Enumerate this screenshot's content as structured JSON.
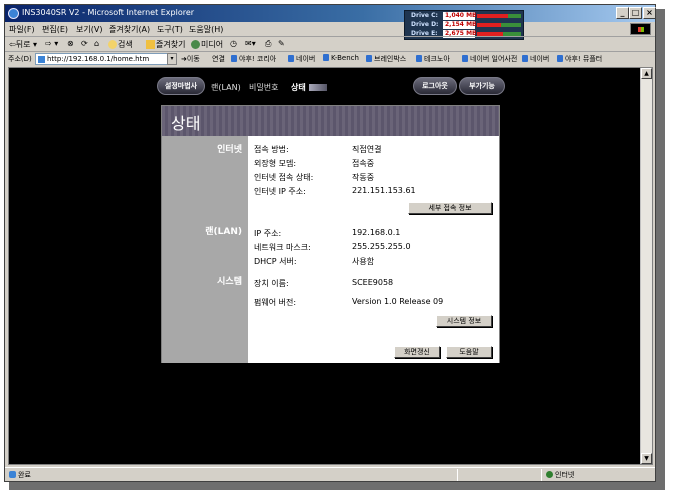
{
  "window": {
    "title": "INS3040SR V2 - Microsoft Internet Explorer",
    "controls": [
      "_",
      "□",
      "×"
    ]
  },
  "drives": [
    {
      "name": "Drive C:",
      "value": "1,040 MB",
      "usage": 0.7
    },
    {
      "name": "Drive D:",
      "value": "2,154 MB",
      "usage": 0.55
    },
    {
      "name": "Drive E:",
      "value": "2,675 MB",
      "usage": 0.6
    }
  ],
  "menu": [
    "파일(F)",
    "편집(E)",
    "보기(V)",
    "즐겨찾기(A)",
    "도구(T)",
    "도움말(H)"
  ],
  "toolbar": {
    "back": "뒤로",
    "search": "검색",
    "favorites": "즐겨찾기",
    "media": "미디어"
  },
  "address": {
    "label": "주소(D)",
    "url": "http://192.168.0.1/home.htm",
    "go": "이동",
    "links_label": "연결",
    "links": [
      "야후! 코리아",
      "네이버",
      "K-Bench",
      "브레인박스",
      "테크노아",
      "네이버 일어사전",
      "네이버",
      "야후! 뮤플터"
    ]
  },
  "nav": {
    "setup_wizard": "설정마법사",
    "items": [
      "랜(LAN)",
      "비밀번호",
      "상태"
    ],
    "logout": "로그아웃",
    "addons": "부가기능"
  },
  "panel": {
    "title": "상태",
    "internet": {
      "section": "인터넷",
      "rows": [
        {
          "k": "접속 방법:",
          "v": "직접연결"
        },
        {
          "k": "외장형 모뎀:",
          "v": "접속중"
        },
        {
          "k": "인터넷 접속 상태:",
          "v": "작동중"
        },
        {
          "k": "인터넷 IP 주소:",
          "v": "221.151.153.61"
        }
      ],
      "button": "세부 접속 정보"
    },
    "lan": {
      "section": "랜(LAN)",
      "rows": [
        {
          "k": "IP 주소:",
          "v": "192.168.0.1"
        },
        {
          "k": "네트워크 마스크:",
          "v": "255.255.255.0"
        },
        {
          "k": "DHCP 서버:",
          "v": "사용함"
        }
      ]
    },
    "system": {
      "section": "시스템",
      "rows": [
        {
          "k": "장치 이름:",
          "v": "SCEE9058"
        },
        {
          "k": "펌웨어 버전:",
          "v": "Version 1.0 Release 09"
        }
      ],
      "button": "시스템 정보"
    },
    "refresh": "화면갱신",
    "help": "도움말"
  },
  "status": {
    "left": "완료",
    "zone": "인터넷"
  },
  "colors": {
    "title_start": "#0a246a",
    "title_end": "#a6caf0",
    "panel_header": "#6a6478",
    "sidebar": "#a8a8a8",
    "content_bg": "#000000"
  }
}
